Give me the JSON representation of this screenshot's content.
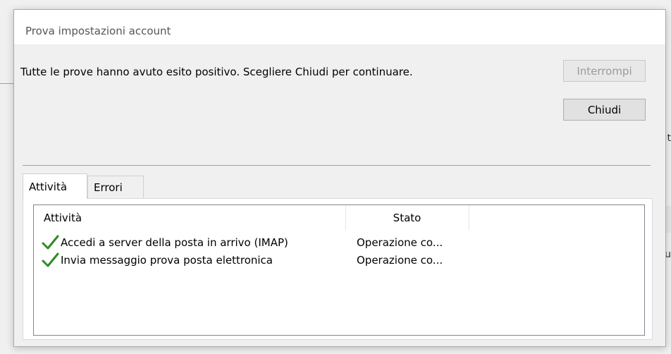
{
  "dialog": {
    "title": "Prova impostazioni account",
    "message": "Tutte le prove hanno avuto esito positivo. Scegliere Chiudi per continuare.",
    "buttons": {
      "stop_label": "Interrompi",
      "close_label": "Chiudi"
    }
  },
  "tabs": [
    {
      "label": "Attività",
      "active": true
    },
    {
      "label": "Errori",
      "active": false
    }
  ],
  "list": {
    "columns": [
      "Attività",
      "Stato"
    ],
    "rows": [
      {
        "task": "Accedi a server della posta in arrivo (IMAP)",
        "status": "Operazione co..."
      },
      {
        "task": "Invia messaggio prova posta elettronica",
        "status": "Operazione co..."
      }
    ]
  },
  "background": {
    "fragment_1": "t",
    "fragment_2": "u"
  },
  "colors": {
    "check_green": "#2e8b22",
    "disabled_text": "#9a9a9a"
  },
  "icons": {
    "row_status": "checkmark-icon"
  }
}
